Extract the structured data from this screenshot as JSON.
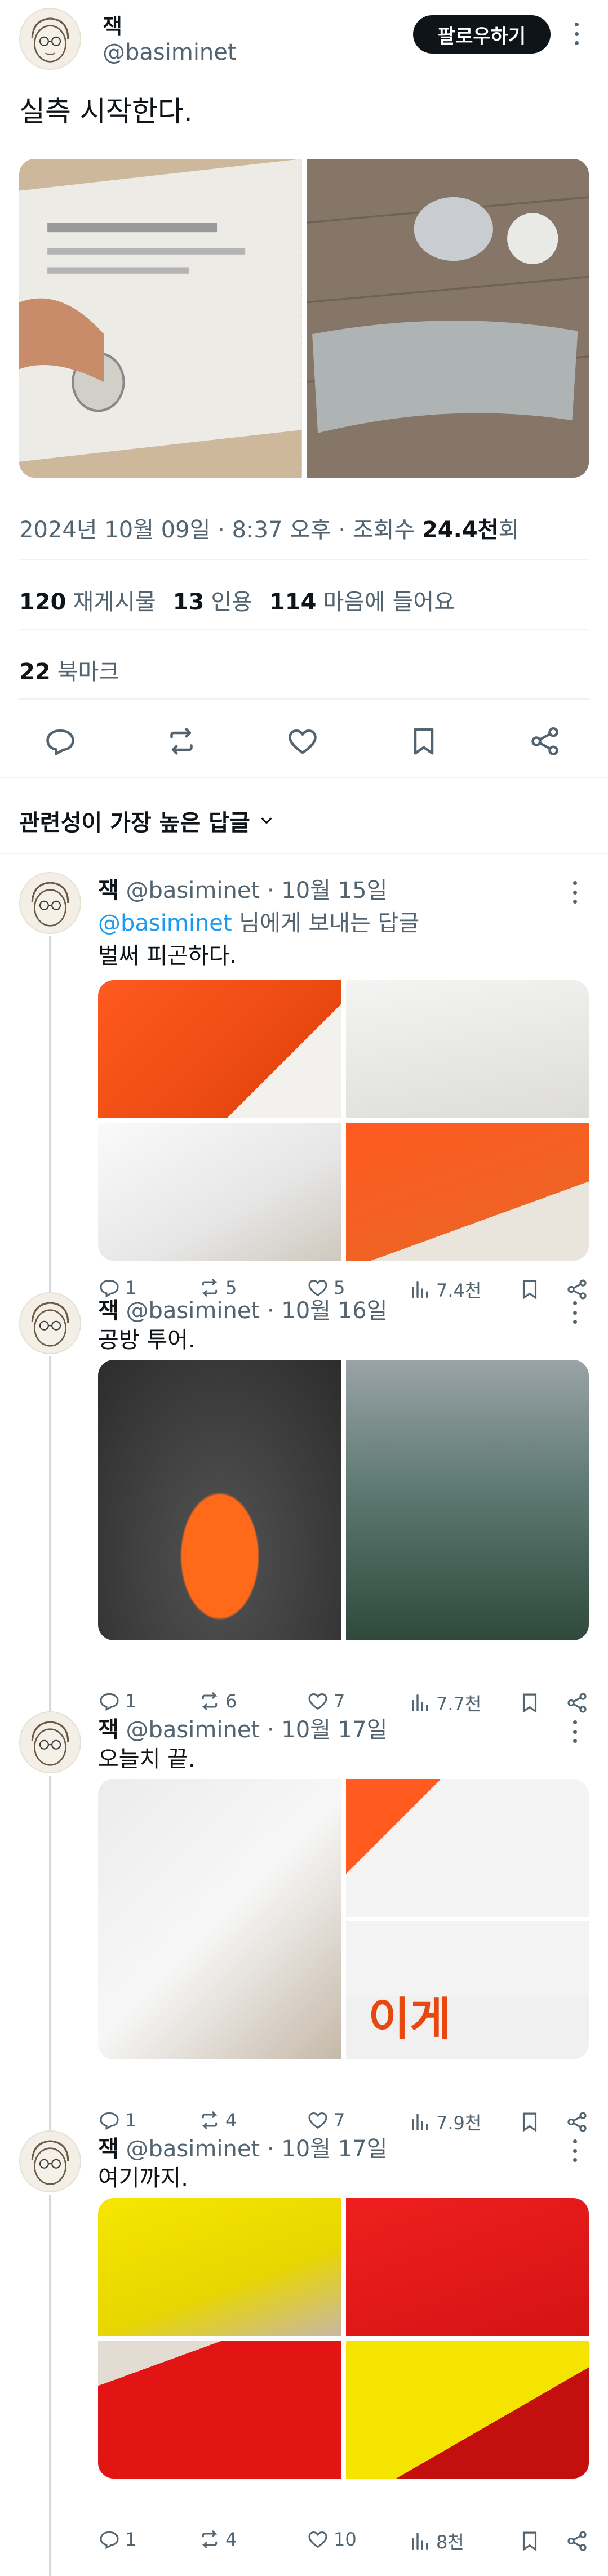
{
  "main_tweet": {
    "author_name": "잭",
    "author_handle": "@basiminet",
    "follow_label": "팔로우하기",
    "text": "실측 시작한다.",
    "timestamp": "2024년 10월 09일 · 8:37 오후 · 조회수 ",
    "views": "24.4천",
    "views_suffix": "회",
    "stats": {
      "reposts_count": "120",
      "reposts_label": "재게시물",
      "quotes_count": "13",
      "quotes_label": "인용",
      "likes_count": "114",
      "likes_label": "마음에 들어요",
      "bookmarks_count": "22",
      "bookmarks_label": "북마크"
    },
    "icons": [
      "reply-icon",
      "repost-icon",
      "like-icon",
      "bookmark-icon",
      "share-icon"
    ]
  },
  "sort": {
    "label": "관련성이 가장 높은 답글"
  },
  "replies": [
    {
      "name": "잭",
      "handle": "@basiminet",
      "date": " · 10월 15일",
      "replying_to": "님에게 보내는 답글",
      "mention": "@basiminet",
      "text": "벌써 피곤하다.",
      "reply_count": "1",
      "repost_count": "5",
      "like_count": "5",
      "views": "7.4천"
    },
    {
      "name": "잭",
      "handle": "@basiminet",
      "date": " · 10월 16일",
      "text": "공방 투어.",
      "reply_count": "1",
      "repost_count": "6",
      "like_count": "7",
      "views": "7.7천"
    },
    {
      "name": "잭",
      "handle": "@basiminet",
      "date": " · 10월 17일",
      "text": "오늘치 끝.",
      "image_text": "이게",
      "reply_count": "1",
      "repost_count": "4",
      "like_count": "7",
      "views": "7.9천"
    },
    {
      "name": "잭",
      "handle": "@basiminet",
      "date": " · 10월 17일",
      "text": "여기까지.",
      "reply_count": "1",
      "repost_count": "4",
      "like_count": "10",
      "views": "8천"
    }
  ]
}
